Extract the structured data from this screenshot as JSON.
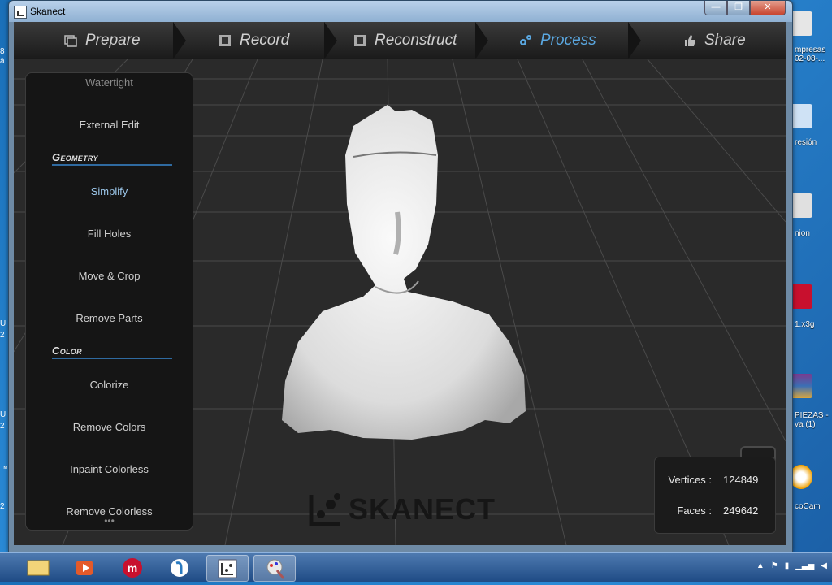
{
  "window": {
    "title": "Skanect",
    "btn_min": "—",
    "btn_max": "❐",
    "btn_close": "✕"
  },
  "nav": {
    "tabs": [
      {
        "label": "Prepare",
        "active": false
      },
      {
        "label": "Record",
        "active": false
      },
      {
        "label": "Reconstruct",
        "active": false
      },
      {
        "label": "Process",
        "active": true
      },
      {
        "label": "Share",
        "active": false
      }
    ]
  },
  "panel": {
    "items": [
      {
        "label": "Watertight"
      },
      {
        "label": "External Edit"
      },
      {
        "section": "Geometry"
      },
      {
        "label": "Simplify"
      },
      {
        "label": "Fill Holes"
      },
      {
        "label": "Move & Crop"
      },
      {
        "label": "Remove Parts"
      },
      {
        "section": "Color"
      },
      {
        "label": "Colorize"
      },
      {
        "label": "Remove Colors"
      },
      {
        "label": "Inpaint Colorless"
      },
      {
        "label": "Remove Colorless"
      }
    ],
    "more": "•••"
  },
  "logo": {
    "text": "SKANECT"
  },
  "stats": {
    "vertices_label": "Vertices :",
    "vertices_value": "124849",
    "faces_label": "Faces :",
    "faces_value": "249642"
  },
  "desktop": {
    "right_labels": [
      "mpresas\n02-08-...",
      "resión",
      "nion",
      "1.x3g",
      "PIEZAS -\nva (1)",
      "coCam"
    ],
    "left_labels": [
      "8",
      "a",
      "U",
      "2",
      "U",
      "2",
      "™",
      "2"
    ]
  },
  "colors": {
    "accent": "#5aa7e0",
    "section_line": "#2f6aa0"
  }
}
